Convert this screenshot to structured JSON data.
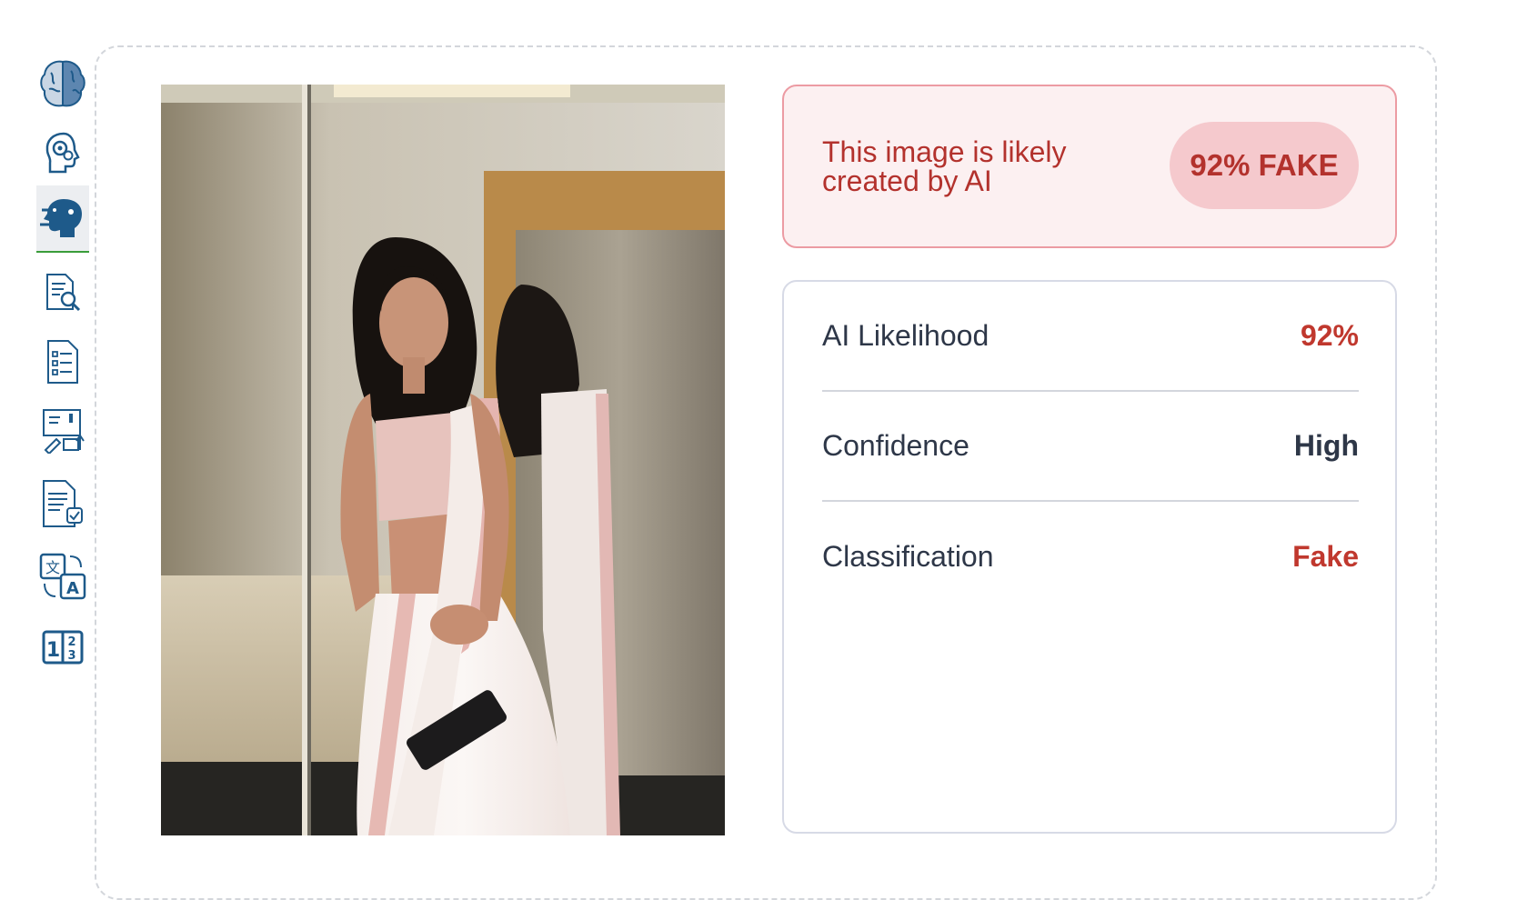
{
  "sidebar": {
    "items": [
      {
        "name": "brain-icon",
        "active": false
      },
      {
        "name": "head-gears-icon",
        "active": false
      },
      {
        "name": "ai-head-icon",
        "active": true
      },
      {
        "name": "document-search-icon",
        "active": false
      },
      {
        "name": "checklist-document-icon",
        "active": false
      },
      {
        "name": "workflow-board-icon",
        "active": false
      },
      {
        "name": "document-check-icon",
        "active": false
      },
      {
        "name": "translate-icon",
        "active": false
      },
      {
        "name": "number-compare-icon",
        "active": false
      }
    ]
  },
  "image": {
    "description": "uploaded photo"
  },
  "verdict": {
    "message": "This image is likely created by AI",
    "badge": "92% FAKE"
  },
  "details": {
    "rows": [
      {
        "label": "AI Likelihood",
        "value": "92%"
      },
      {
        "label": "Confidence",
        "value": "High"
      },
      {
        "label": "Classification",
        "value": "Fake"
      }
    ]
  },
  "colors": {
    "accent_red": "#c0382e",
    "verdict_bg": "#fcf0f1",
    "verdict_border": "#ec9ba3",
    "badge_bg": "#f5c9cd",
    "icon_blue": "#1e5a8a",
    "active_underline": "#3a9d3a"
  }
}
